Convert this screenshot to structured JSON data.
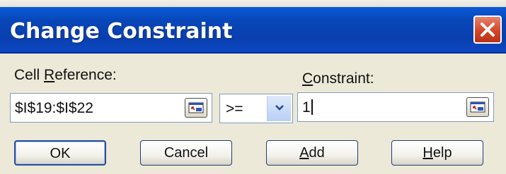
{
  "window": {
    "title": "Change Constraint",
    "close_icon": "close-icon"
  },
  "cell_reference": {
    "label_pre": "Cell ",
    "label_mnemonic": "R",
    "label_post": "eference:",
    "value": "$I$19:$I$22"
  },
  "operator": {
    "selected": ">="
  },
  "constraint": {
    "label_mnemonic": "C",
    "label_post": "onstraint:",
    "value": "1"
  },
  "buttons": {
    "ok": "OK",
    "cancel": "Cancel",
    "add_mnemonic": "A",
    "add_post": "dd",
    "help_mnemonic": "H",
    "help_post": "elp"
  },
  "colors": {
    "titlebar": "#0846b8",
    "close": "#d2472a",
    "face": "#ece9d8"
  }
}
